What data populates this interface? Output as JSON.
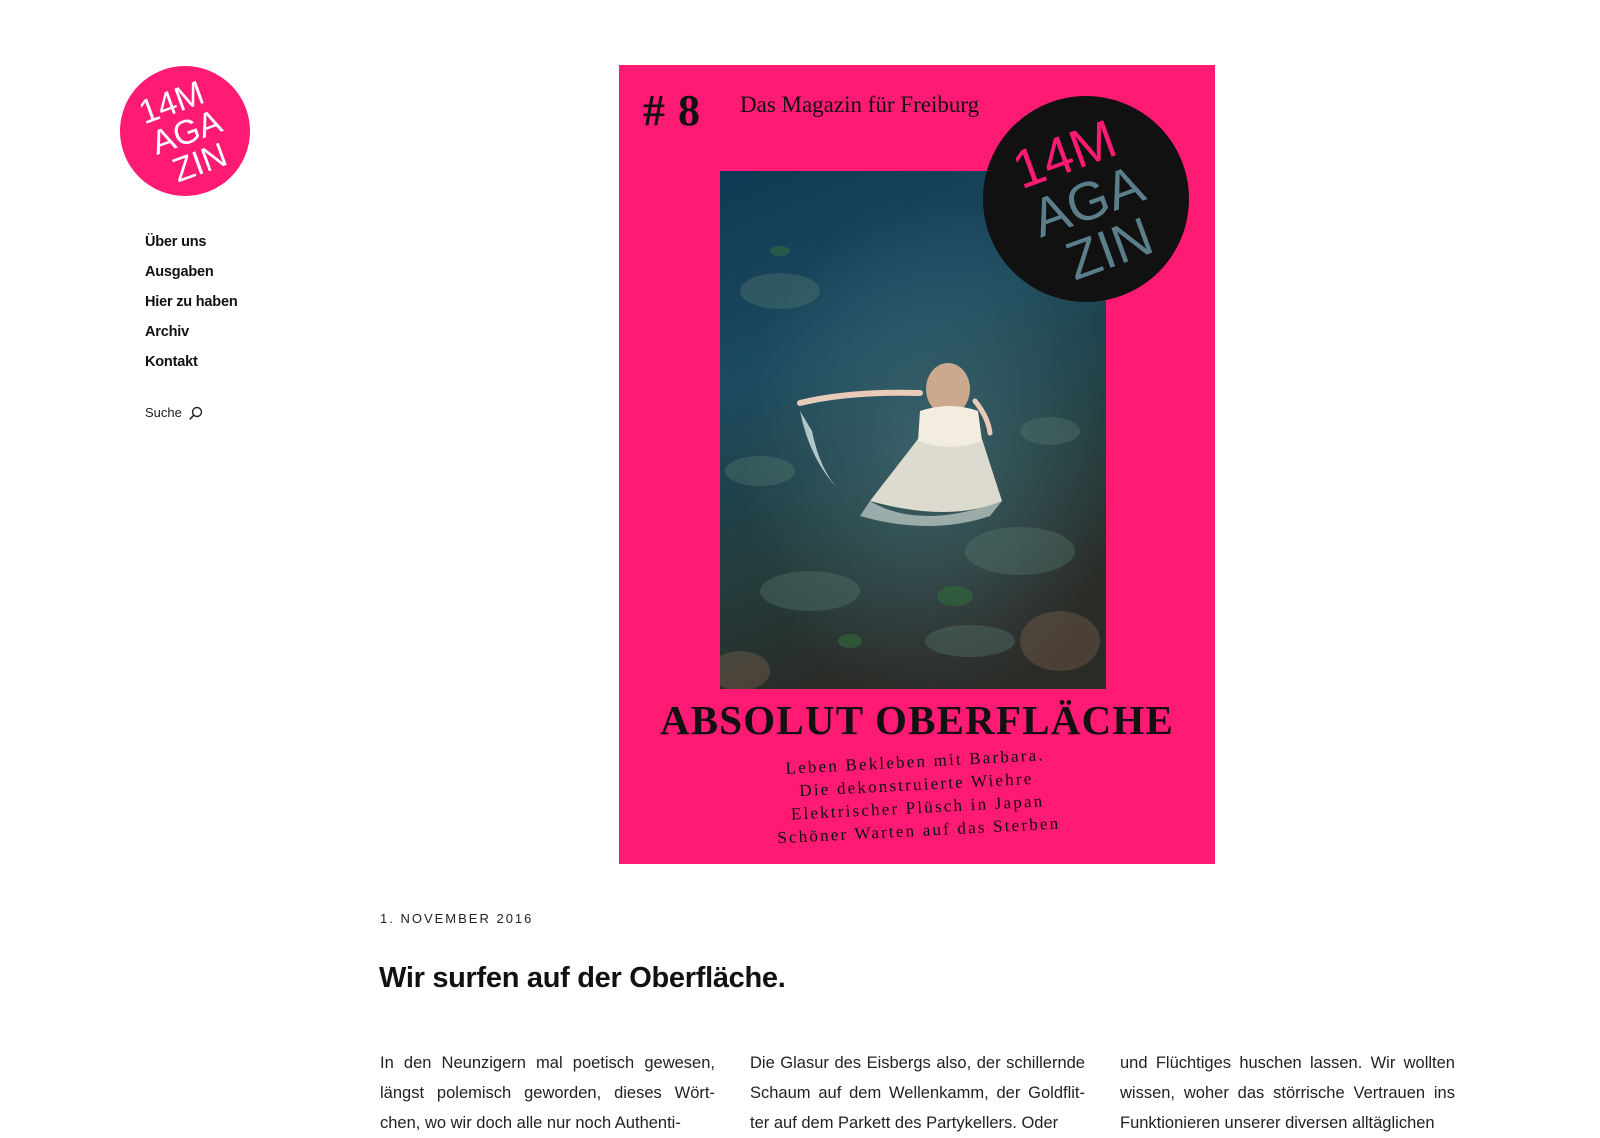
{
  "site": {
    "logo_text": [
      "14M",
      "AGA",
      "ZIN"
    ],
    "brand_color": "#ff1a73"
  },
  "nav": {
    "items": [
      {
        "label": "Über uns"
      },
      {
        "label": "Ausgaben"
      },
      {
        "label": "Hier zu haben"
      },
      {
        "label": "Archiv"
      },
      {
        "label": "Kontakt"
      }
    ],
    "search_label": "Suche",
    "search_icon": "search-icon"
  },
  "cover": {
    "issue": "# 8",
    "tagline": "Das Magazin für Freiburg",
    "headline": "ABSOLUT OBERFLÄCHE",
    "teasers": [
      "Leben Bekleben mit Barbara.",
      "Die dekonstruierte Wiehre",
      "Elektrischer Plüsch in Japan",
      "Schöner Warten auf das Sterben"
    ],
    "background": "#ff1a73"
  },
  "post": {
    "date": "1. November 2016",
    "title": "Wir surfen auf der Oberfläche.",
    "columns": [
      "In den Neunzigern mal poetisch gewesen, längst polemisch geworden, dieses Wört- chen, wo wir doch alle nur noch Authenti-",
      "Die Glasur des Eisbergs also, der schillernde Schaum auf dem Wellenkamm, der Goldflit- ter auf dem Parkett des Partykellers. Oder",
      "und Flüchtiges huschen lassen. Wir wollten wissen, woher das störrische Vertrauen ins Funktionieren unserer diversen alltäglichen"
    ]
  }
}
